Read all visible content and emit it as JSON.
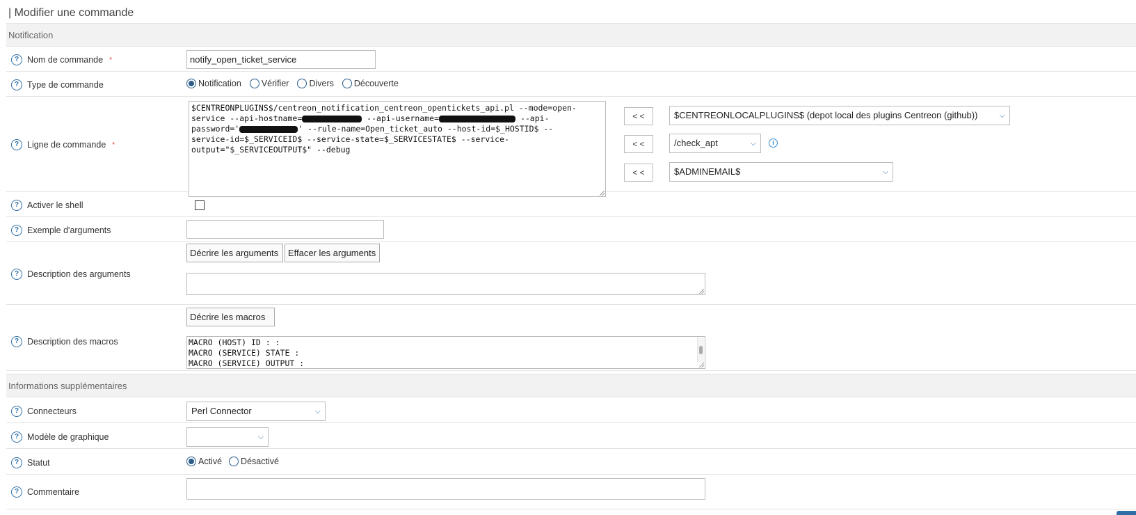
{
  "page": {
    "title": "| Modifier une commande"
  },
  "sections": {
    "notification": "Notification",
    "additional": "Informations supplémentaires"
  },
  "fields": {
    "command_name": {
      "label": "Nom de commande",
      "value": "notify_open_ticket_service"
    },
    "command_type": {
      "label": "Type de commande",
      "options": [
        "Notification",
        "Vérifier",
        "Divers",
        "Découverte"
      ],
      "selected": "Notification"
    },
    "command_line": {
      "label": "Ligne de commande",
      "line1": "$CENTREONPLUGINS$/centreon_notification_centreon_opentickets_api.pl --mode=open-",
      "line2a": "service --api-hostname=",
      "line2b": " --api-username=",
      "line2c": " --api-",
      "line3a": "password='",
      "line3b": "' --rule-name=Open_ticket_auto --host-id=$_HOSTID$ --",
      "line4": "service-id=$_SERVICEID$ --service-state=$_SERVICESTATE$ --service-",
      "line5": "output=\"$_SERVICEOUTPUT$\" --debug"
    },
    "insert_button": "< <",
    "plugin_dir_select": "$CENTREONLOCALPLUGINS$ (depot local des plugins Centreon (github))",
    "plugin_select": "/check_apt",
    "macro_select": "$ADMINEMAIL$",
    "enable_shell": {
      "label": "Activer le shell"
    },
    "argument_example": {
      "label": "Exemple d'arguments",
      "value": ""
    },
    "argument_description": {
      "label": "Description des arguments",
      "describe_button": "Décrire les arguments",
      "clear_button": "Effacer les arguments"
    },
    "macro_description": {
      "label": "Description des macros",
      "describe_button": "Décrire les macros",
      "text": "MACRO (HOST) ID : :\nMACRO (SERVICE) STATE :\nMACRO (SERVICE) OUTPUT :"
    },
    "connectors": {
      "label": "Connecteurs",
      "value": "Perl Connector"
    },
    "graph_template": {
      "label": "Modèle de graphique",
      "value": ""
    },
    "status": {
      "label": "Statut",
      "options": [
        "Activé",
        "Désactivé"
      ],
      "selected": "Activé"
    },
    "comment": {
      "label": "Commentaire",
      "value": ""
    }
  },
  "icons": {
    "help": "?",
    "info": "i",
    "chevron": "⌵"
  }
}
